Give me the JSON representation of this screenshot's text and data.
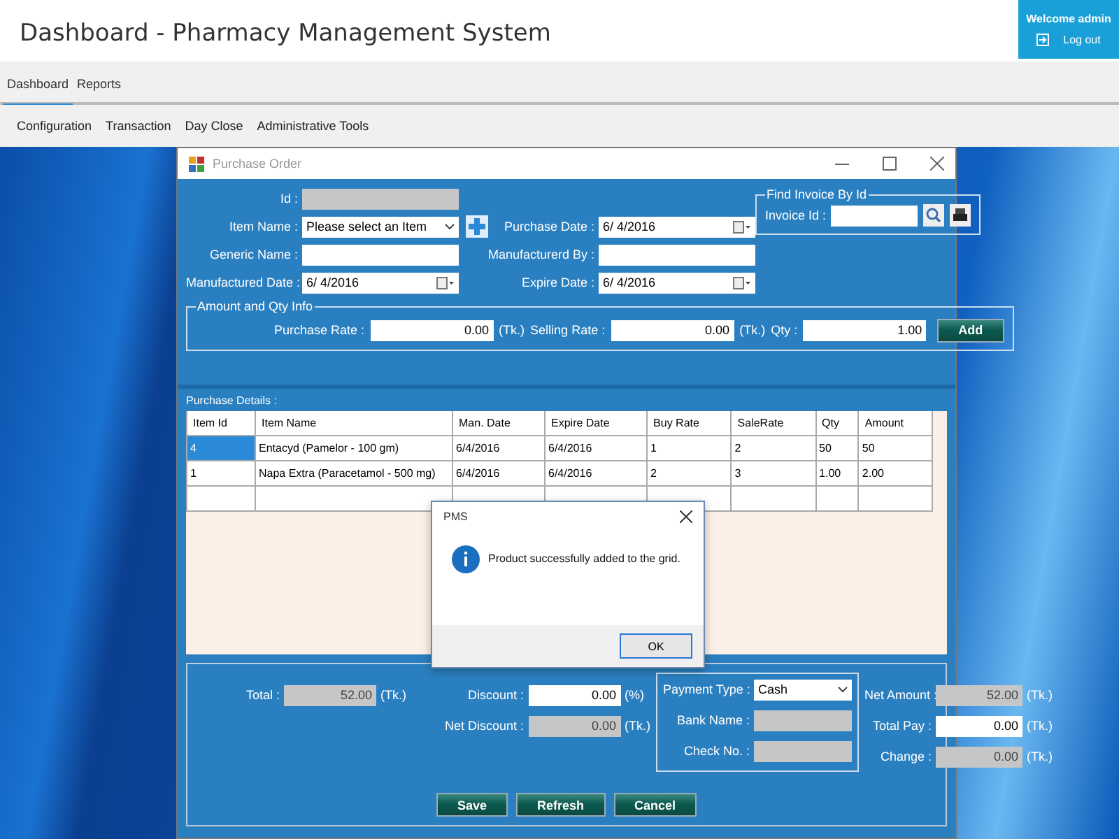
{
  "app": {
    "title": "Dashboard - Pharmacy Management System"
  },
  "user_box": {
    "welcome": "Welcome admin",
    "logout": "Log out"
  },
  "tabs": [
    {
      "label": "Dashboard",
      "selected": true
    },
    {
      "label": "Reports",
      "selected": false
    }
  ],
  "menu": [
    "Configuration",
    "Transaction",
    "Day Close",
    "Administrative Tools"
  ],
  "window": {
    "title": "Purchase Order",
    "form_left": [
      {
        "label": "Id :",
        "kind": "text",
        "disabled": true
      },
      {
        "label": "Item Name :",
        "kind": "combo",
        "value": "Please select an Item",
        "disabled": false
      },
      {
        "label": "Generic Name :",
        "kind": "text",
        "disabled": false
      },
      {
        "label": "Manufactured Date :",
        "kind": "date",
        "value": "6/ 4/2016",
        "disabled": false
      }
    ],
    "form_right": [
      {
        "label": "Purchase Date :",
        "kind": "date",
        "value": "6/ 4/2016",
        "disabled": false
      },
      {
        "label": "Manufacturerd By :",
        "kind": "text",
        "disabled": false
      },
      {
        "label": "Expire Date :",
        "kind": "date",
        "value": "6/ 4/2016",
        "disabled": false
      }
    ],
    "find_invoice": {
      "legend": "Find Invoice By Id",
      "label": "Invoice Id :"
    },
    "amount_group": {
      "legend": "Amount and Qty Info",
      "fields": [
        {
          "label": "Purchase Rate :",
          "value": "0.00",
          "unit": "(Tk.)"
        },
        {
          "label": "Selling Rate :",
          "value": "0.00",
          "unit": "(Tk.)"
        },
        {
          "label": "Qty :",
          "value": "1.00"
        }
      ],
      "add_button": "Add"
    },
    "details": {
      "title": "Purchase Details :",
      "columns": [
        "Item Id",
        "Item Name",
        "Man. Date",
        "Expire Date",
        "Buy Rate",
        "SaleRate",
        "Qty",
        "Amount"
      ],
      "rows": [
        {
          "selected": true,
          "cells": [
            "4",
            "Entacyd (Pamelor - 100 gm)",
            "6/4/2016",
            "6/4/2016",
            "1",
            "2",
            "50",
            "50"
          ]
        },
        {
          "selected": false,
          "cells": [
            "1",
            "Napa Extra (Paracetamol - 500 mg)",
            "6/4/2016",
            "6/4/2016",
            "2",
            "3",
            "1.00",
            "2.00"
          ]
        }
      ]
    },
    "totals_left": [
      {
        "label": "Total :",
        "value": "52.00",
        "unit": "(Tk.)",
        "disabled": true
      },
      {
        "label": "Discount :",
        "value": "0.00",
        "unit": "(%)",
        "disabled": false
      },
      {
        "label": "Net Discount :",
        "value": "0.00",
        "unit": "(Tk.)",
        "disabled": true
      }
    ],
    "payment": [
      {
        "label": "Payment Type :",
        "kind": "combo",
        "value": "Cash",
        "disabled": false
      },
      {
        "label": "Bank Name :",
        "kind": "text",
        "disabled": true
      },
      {
        "label": "Check No. :",
        "kind": "text",
        "disabled": true
      }
    ],
    "totals_right": [
      {
        "label": "Net Amount :",
        "value": "52.00",
        "unit": "(Tk.)",
        "disabled": true
      },
      {
        "label": "Total Pay :",
        "value": "0.00",
        "unit": "(Tk.)",
        "disabled": false
      },
      {
        "label": "Change :",
        "value": "0.00",
        "unit": "(Tk.)",
        "disabled": true
      }
    ],
    "buttons": [
      "Save",
      "Refresh",
      "Cancel"
    ]
  },
  "dialog": {
    "title": "PMS",
    "message": "Product successfully added to the grid.",
    "button": "OK"
  }
}
